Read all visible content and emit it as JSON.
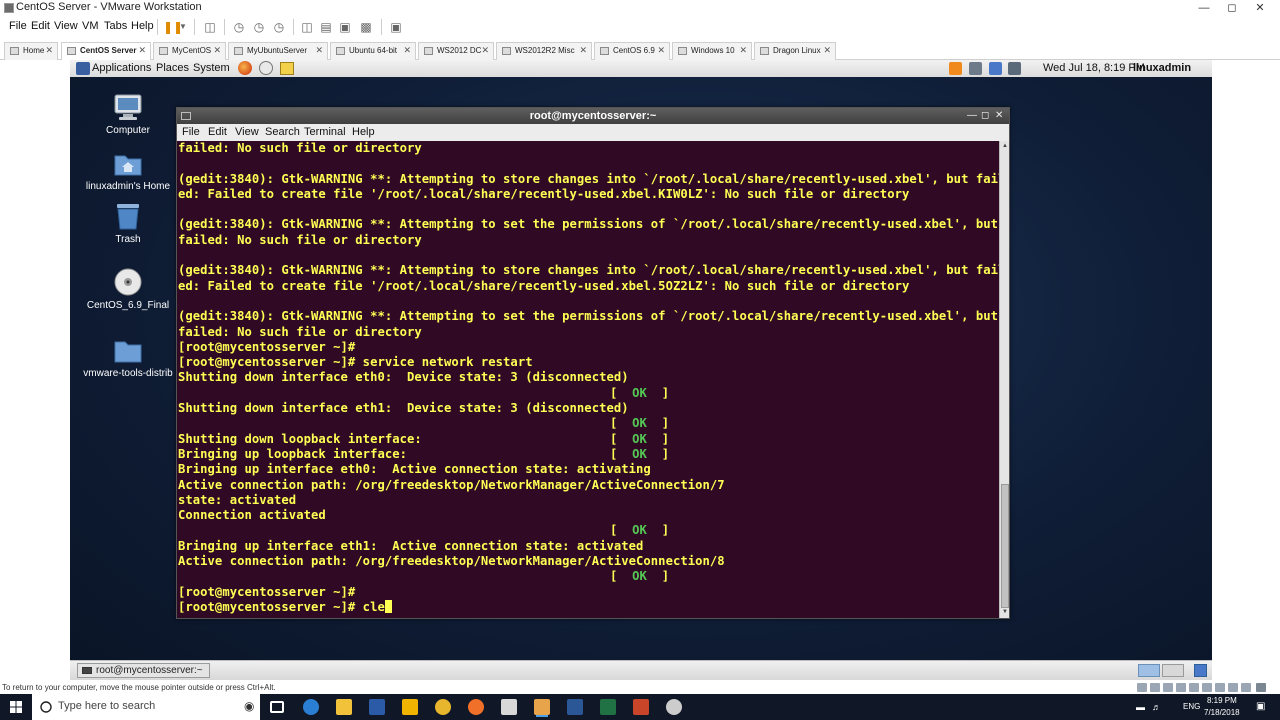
{
  "vmware": {
    "window_title": "CentOS Server - VMware Workstation",
    "menu": [
      "File",
      "Edit",
      "View",
      "VM",
      "Tabs",
      "Help"
    ],
    "tabs": [
      {
        "label": "Home",
        "active": false
      },
      {
        "label": "CentOS Server",
        "active": true
      },
      {
        "label": "MyCentOS",
        "active": false
      },
      {
        "label": "MyUbuntuServer",
        "active": false
      },
      {
        "label": "Ubuntu 64-bit",
        "active": false
      },
      {
        "label": "WS2012 DC",
        "active": false
      },
      {
        "label": "WS2012R2 Misc",
        "active": false
      },
      {
        "label": "CentOS 6.9",
        "active": false
      },
      {
        "label": "Windows 10",
        "active": false
      },
      {
        "label": "Dragon Linux",
        "active": false
      }
    ],
    "status_hint": "To return to your computer, move the mouse pointer outside or press Ctrl+Alt."
  },
  "gnome": {
    "menu": [
      "Applications",
      "Places",
      "System"
    ],
    "clock": "Wed Jul 18,  8:19 PM",
    "user": "linuxadmin",
    "task_button": "root@mycentosserver:~",
    "tray_colors": [
      "#f08a1c",
      "#6c7a8a",
      "#4a78c8",
      "#5a6a7a"
    ]
  },
  "desktop": {
    "icons": [
      {
        "label": "Computer",
        "icon": "computer-icon"
      },
      {
        "label": "linuxadmin's Home",
        "icon": "home-folder-icon"
      },
      {
        "label": "Trash",
        "icon": "trash-icon"
      },
      {
        "label": "CentOS_6.9_Final",
        "icon": "dvd-icon"
      },
      {
        "label": "vmware-tools-distrib",
        "icon": "folder-icon"
      }
    ]
  },
  "terminal": {
    "title": "root@mycentosserver:~",
    "menu": [
      "File",
      "Edit",
      "View",
      "Search",
      "Terminal",
      "Help"
    ],
    "lines": [
      "failed: No such file or directory",
      "",
      "(gedit:3840): Gtk-WARNING **: Attempting to store changes into `/root/.local/share/recently-used.xbel', but fail",
      "ed: Failed to create file '/root/.local/share/recently-used.xbel.KIW0LZ': No such file or directory",
      "",
      "(gedit:3840): Gtk-WARNING **: Attempting to set the permissions of `/root/.local/share/recently-used.xbel', but",
      "failed: No such file or directory",
      "",
      "(gedit:3840): Gtk-WARNING **: Attempting to store changes into `/root/.local/share/recently-used.xbel', but fail",
      "ed: Failed to create file '/root/.local/share/recently-used.xbel.5OZ2LZ': No such file or directory",
      "",
      "(gedit:3840): Gtk-WARNING **: Attempting to set the permissions of `/root/.local/share/recently-used.xbel', but",
      "failed: No such file or directory",
      "[root@mycentosserver ~]#",
      "[root@mycentosserver ~]# service network restart",
      "Shutting down interface eth0:  Device state: 3 (disconnected)",
      "",
      "Shutting down interface eth1:  Device state: 3 (disconnected)",
      "",
      "Shutting down loopback interface:",
      "Bringing up loopback interface:",
      "Bringing up interface eth0:  Active connection state: activating",
      "Active connection path: /org/freedesktop/NetworkManager/ActiveConnection/7",
      "state: activated",
      "Connection activated",
      "",
      "Bringing up interface eth1:  Active connection state: activated",
      "Active connection path: /org/freedesktop/NetworkManager/ActiveConnection/8",
      "",
      "[root@mycentosserver ~]#",
      "[root@mycentosserver ~]# cle"
    ],
    "ok_lines": [
      16,
      18,
      19,
      20,
      25,
      28
    ],
    "ok_text": "[  OK  ]",
    "colors": {
      "background": "#300a24",
      "text": "#ffff54",
      "ok": "#54c854"
    }
  },
  "windows": {
    "search_placeholder": "Type here to search",
    "tray_lang": "ENG",
    "time": "8:19 PM",
    "date": "7/18/2018",
    "apps": [
      {
        "name": "task-view-icon",
        "color": "#ffffff"
      },
      {
        "name": "edge-icon",
        "color": "#2a7fd4"
      },
      {
        "name": "file-explorer-icon",
        "color": "#f2c23a"
      },
      {
        "name": "powershell-icon",
        "color": "#2b5aa6"
      },
      {
        "name": "store-icon",
        "color": "#f0b400"
      },
      {
        "name": "chrome-icon",
        "color": "#e7b62c"
      },
      {
        "name": "firefox-icon",
        "color": "#f0702a"
      },
      {
        "name": "mail-icon",
        "color": "#d8d8d8"
      },
      {
        "name": "vmware-icon",
        "color": "#e8a44a"
      },
      {
        "name": "word-icon",
        "color": "#2b5797"
      },
      {
        "name": "excel-icon",
        "color": "#207245"
      },
      {
        "name": "powerpoint-icon",
        "color": "#c9452a"
      },
      {
        "name": "settings-icon",
        "color": "#cccccc"
      }
    ]
  }
}
